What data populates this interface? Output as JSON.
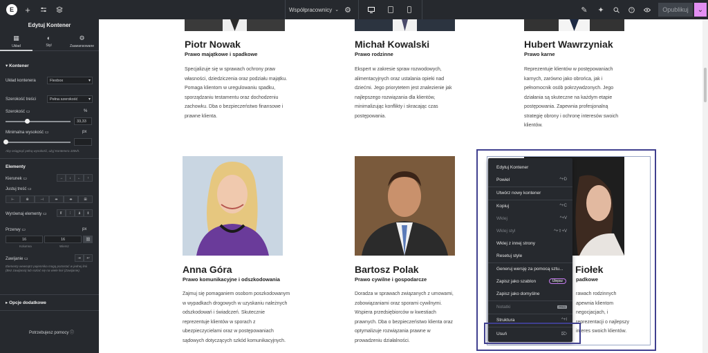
{
  "topbar": {
    "page_selector": "Współpracownicy",
    "publish": "Opublikuj"
  },
  "panel": {
    "title": "Edytuj Kontener",
    "tabs": [
      {
        "label": "Układ",
        "icon": "layout-icon"
      },
      {
        "label": "Styl",
        "icon": "style-icon"
      },
      {
        "label": "Zaawansowane",
        "icon": "gear-icon"
      }
    ],
    "section_container": "Kontener",
    "layout_label": "Układ kontenera",
    "layout_value": "Flexbox",
    "content_width_label": "Szerokość treści",
    "content_width_value": "Pełna szerokość",
    "width_label": "Szerokość",
    "width_unit": "%",
    "width_value": "33,33",
    "width_fraction": 0.3333,
    "min_height_label": "Minimalna wysokość",
    "min_height_unit": "px",
    "min_height_note": "Aby osiągnąć pełną wysokość, użyj Kontenera 100vh.",
    "elements_head": "Elementy",
    "direction_label": "Kierunek",
    "justify_label": "Justuj treść",
    "align_label": "Wyrównaj elementy",
    "gaps_label": "Przerwy",
    "gaps_unit": "px",
    "gap_column": "16",
    "gap_row": "16",
    "gap_column_label": "Kolumna",
    "gap_row_label": "Wiersz",
    "wrap_label": "Zawijanie",
    "wrap_note": "Elementy wewnątrz pojemnika mogą pozostać w jednej linii (Bez zawijania) lub rozlać się na wiele linii (Zawijanie).",
    "extra_options": "Opcje dodatkowe",
    "help": "Potrzebujesz pomocy"
  },
  "team": [
    {
      "name": "Piotr Nowak",
      "role": "Prawo majątkowe i spadkowe",
      "desc": "Specjalizuje się w sprawach ochrony praw własności, dziedziczenia oraz podziału majątku. Pomaga klientom w uregulowaniu spadku, sporządzaniu testamentu oraz dochodzeniu zachowku. Dba o bezpieczeństwo finansowe i prawne klienta."
    },
    {
      "name": "Michał Kowalski",
      "role": "Prawo rodzinne",
      "desc": "Ekspert w zakresie spraw rozwodowych, alimentacyjnych oraz ustalania opieki nad dziećmi. Jego priorytetem jest znalezienie jak najlepszego rozwiązania dla klientów, minimalizując konflikty i skracając czas postępowania."
    },
    {
      "name": "Hubert Wawrzyniak",
      "role": "Prawo karne",
      "desc": "Reprezentuje klientów w postępowaniach karnych, zarówno jako obrońca, jak i pełnomocnik osób pokrzywdzonych. Jego działania są skuteczne na każdym etapie postępowania. Zapewnia profesjonalną strategię obrony i ochronę interesów swoich klientów."
    },
    {
      "name": "Anna Góra",
      "role": "Prawo komunikacyjne i odszkodowania",
      "desc": "Zajmuj się pomaganiem osobom poszkodowanym w wypadkach drogowych w uzyskaniu należnych odszkodowań i świadczeń. Skutecznie reprezentuje klientów w sporach z ubezpieczycielami oraz w postępowaniach sądowych dotyczących szkód komunikacyjnych."
    },
    {
      "name": "Bartosz Polak",
      "role": "Prawo cywilne i gospodarcze",
      "desc": "Doradza w sprawach związanych z umowami, zobowiązaniami oraz sporami cywilnymi. Wspiera przedsiębiorców w kwestiach prawnych. Dba o bezpieczeństwo klienta oraz optymalizuje rozwiązania prawne w prowadzeniu działalności."
    },
    {
      "name": "Fiołek",
      "role": "padkowe",
      "desc": "rawach rodzinnych apewnia klientom negocjacjach, i reprezentacji o najlepszy interes swoich klientów."
    }
  ],
  "context_menu": {
    "items": [
      {
        "label": "Edytuj Kontener",
        "shortcut": "",
        "disabled": false
      },
      {
        "label": "Powiel",
        "shortcut": "^+D",
        "disabled": false
      },
      {
        "label": "Utwórz nowy kontener",
        "shortcut": "",
        "disabled": false
      },
      {
        "label": "Kopiuj",
        "shortcut": "^+C",
        "disabled": false
      },
      {
        "label": "Wklej",
        "shortcut": "^+V",
        "disabled": true
      },
      {
        "label": "Wklej styl",
        "shortcut": "^+⇧+V",
        "disabled": true
      },
      {
        "label": "Wklej z innej strony",
        "shortcut": "",
        "disabled": false
      },
      {
        "label": "Resetuj style",
        "shortcut": "",
        "disabled": false
      },
      {
        "label": "Generuj wersję za pomocą sztu...",
        "shortcut": "",
        "disabled": false
      },
      {
        "label": "Zapisz jako szablon",
        "shortcut": "",
        "badge": "Ulepsz",
        "disabled": false
      },
      {
        "label": "Zapisz jako domyślne",
        "shortcut": "",
        "disabled": false
      },
      {
        "label": "Notatki",
        "shortcut": "",
        "pro": "PRO",
        "disabled": true
      },
      {
        "label": "Struktura",
        "shortcut": "^+I",
        "disabled": false
      },
      {
        "label": "Usuń",
        "shortcut": "⌦",
        "disabled": false
      }
    ]
  }
}
